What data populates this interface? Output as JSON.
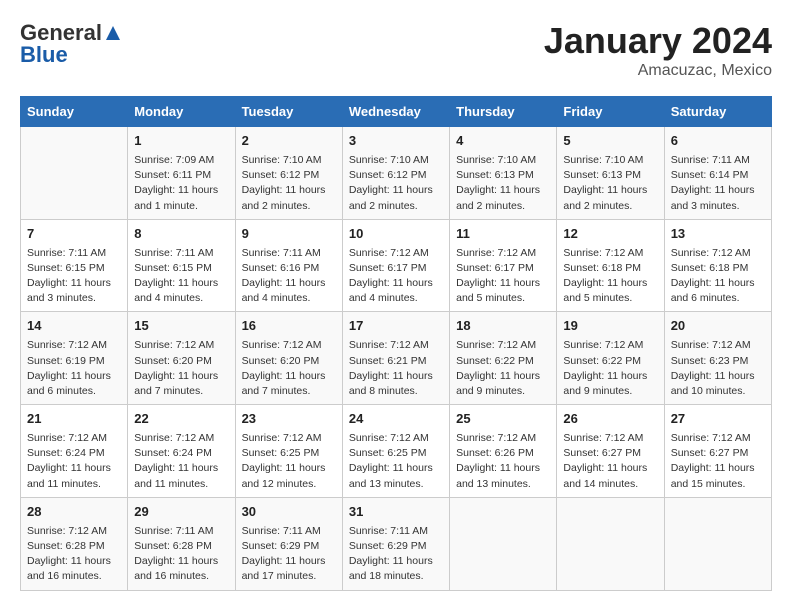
{
  "header": {
    "logo_general": "General",
    "logo_blue": "Blue",
    "title": "January 2024",
    "subtitle": "Amacuzac, Mexico"
  },
  "days_of_week": [
    "Sunday",
    "Monday",
    "Tuesday",
    "Wednesday",
    "Thursday",
    "Friday",
    "Saturday"
  ],
  "weeks": [
    [
      {
        "day": "",
        "info": ""
      },
      {
        "day": "1",
        "info": "Sunrise: 7:09 AM\nSunset: 6:11 PM\nDaylight: 11 hours\nand 1 minute."
      },
      {
        "day": "2",
        "info": "Sunrise: 7:10 AM\nSunset: 6:12 PM\nDaylight: 11 hours\nand 2 minutes."
      },
      {
        "day": "3",
        "info": "Sunrise: 7:10 AM\nSunset: 6:12 PM\nDaylight: 11 hours\nand 2 minutes."
      },
      {
        "day": "4",
        "info": "Sunrise: 7:10 AM\nSunset: 6:13 PM\nDaylight: 11 hours\nand 2 minutes."
      },
      {
        "day": "5",
        "info": "Sunrise: 7:10 AM\nSunset: 6:13 PM\nDaylight: 11 hours\nand 2 minutes."
      },
      {
        "day": "6",
        "info": "Sunrise: 7:11 AM\nSunset: 6:14 PM\nDaylight: 11 hours\nand 3 minutes."
      }
    ],
    [
      {
        "day": "7",
        "info": "Sunrise: 7:11 AM\nSunset: 6:15 PM\nDaylight: 11 hours\nand 3 minutes."
      },
      {
        "day": "8",
        "info": "Sunrise: 7:11 AM\nSunset: 6:15 PM\nDaylight: 11 hours\nand 4 minutes."
      },
      {
        "day": "9",
        "info": "Sunrise: 7:11 AM\nSunset: 6:16 PM\nDaylight: 11 hours\nand 4 minutes."
      },
      {
        "day": "10",
        "info": "Sunrise: 7:12 AM\nSunset: 6:17 PM\nDaylight: 11 hours\nand 4 minutes."
      },
      {
        "day": "11",
        "info": "Sunrise: 7:12 AM\nSunset: 6:17 PM\nDaylight: 11 hours\nand 5 minutes."
      },
      {
        "day": "12",
        "info": "Sunrise: 7:12 AM\nSunset: 6:18 PM\nDaylight: 11 hours\nand 5 minutes."
      },
      {
        "day": "13",
        "info": "Sunrise: 7:12 AM\nSunset: 6:18 PM\nDaylight: 11 hours\nand 6 minutes."
      }
    ],
    [
      {
        "day": "14",
        "info": "Sunrise: 7:12 AM\nSunset: 6:19 PM\nDaylight: 11 hours\nand 6 minutes."
      },
      {
        "day": "15",
        "info": "Sunrise: 7:12 AM\nSunset: 6:20 PM\nDaylight: 11 hours\nand 7 minutes."
      },
      {
        "day": "16",
        "info": "Sunrise: 7:12 AM\nSunset: 6:20 PM\nDaylight: 11 hours\nand 7 minutes."
      },
      {
        "day": "17",
        "info": "Sunrise: 7:12 AM\nSunset: 6:21 PM\nDaylight: 11 hours\nand 8 minutes."
      },
      {
        "day": "18",
        "info": "Sunrise: 7:12 AM\nSunset: 6:22 PM\nDaylight: 11 hours\nand 9 minutes."
      },
      {
        "day": "19",
        "info": "Sunrise: 7:12 AM\nSunset: 6:22 PM\nDaylight: 11 hours\nand 9 minutes."
      },
      {
        "day": "20",
        "info": "Sunrise: 7:12 AM\nSunset: 6:23 PM\nDaylight: 11 hours\nand 10 minutes."
      }
    ],
    [
      {
        "day": "21",
        "info": "Sunrise: 7:12 AM\nSunset: 6:24 PM\nDaylight: 11 hours\nand 11 minutes."
      },
      {
        "day": "22",
        "info": "Sunrise: 7:12 AM\nSunset: 6:24 PM\nDaylight: 11 hours\nand 11 minutes."
      },
      {
        "day": "23",
        "info": "Sunrise: 7:12 AM\nSunset: 6:25 PM\nDaylight: 11 hours\nand 12 minutes."
      },
      {
        "day": "24",
        "info": "Sunrise: 7:12 AM\nSunset: 6:25 PM\nDaylight: 11 hours\nand 13 minutes."
      },
      {
        "day": "25",
        "info": "Sunrise: 7:12 AM\nSunset: 6:26 PM\nDaylight: 11 hours\nand 13 minutes."
      },
      {
        "day": "26",
        "info": "Sunrise: 7:12 AM\nSunset: 6:27 PM\nDaylight: 11 hours\nand 14 minutes."
      },
      {
        "day": "27",
        "info": "Sunrise: 7:12 AM\nSunset: 6:27 PM\nDaylight: 11 hours\nand 15 minutes."
      }
    ],
    [
      {
        "day": "28",
        "info": "Sunrise: 7:12 AM\nSunset: 6:28 PM\nDaylight: 11 hours\nand 16 minutes."
      },
      {
        "day": "29",
        "info": "Sunrise: 7:11 AM\nSunset: 6:28 PM\nDaylight: 11 hours\nand 16 minutes."
      },
      {
        "day": "30",
        "info": "Sunrise: 7:11 AM\nSunset: 6:29 PM\nDaylight: 11 hours\nand 17 minutes."
      },
      {
        "day": "31",
        "info": "Sunrise: 7:11 AM\nSunset: 6:29 PM\nDaylight: 11 hours\nand 18 minutes."
      },
      {
        "day": "",
        "info": ""
      },
      {
        "day": "",
        "info": ""
      },
      {
        "day": "",
        "info": ""
      }
    ]
  ]
}
